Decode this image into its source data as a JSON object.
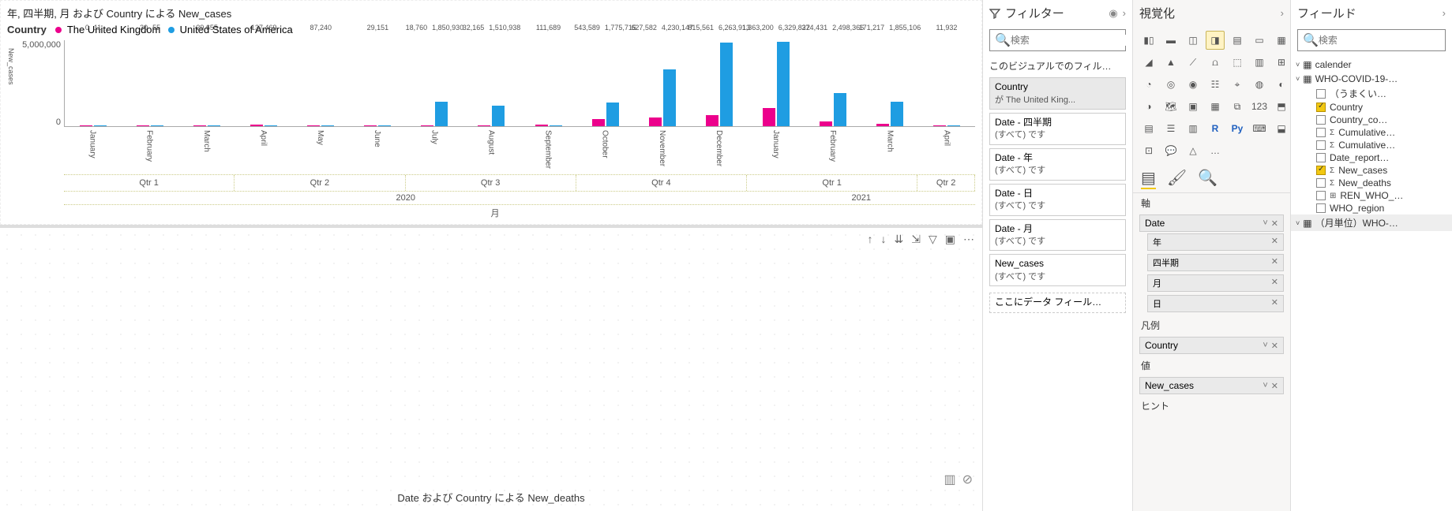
{
  "chart_data": {
    "type": "bar",
    "title": "年, 四半期, 月 および Country による New_cases",
    "ylabel": "New_cases",
    "xlabel": "月",
    "ylim": [
      0,
      6500000
    ],
    "yticks": [
      "5,000,000",
      "0"
    ],
    "legend": {
      "field": "Country",
      "items": [
        "The United Kingdom",
        "United States of America"
      ]
    },
    "categories": [
      "January",
      "February",
      "March",
      "April",
      "May",
      "June",
      "July",
      "August",
      "September",
      "October",
      "November",
      "December",
      "January",
      "February",
      "March",
      "April"
    ],
    "quarters": [
      "Qtr 1",
      "Qtr 2",
      "Qtr 3",
      "Qtr 4",
      "Qtr 1",
      "Qtr 2"
    ],
    "quarter_spans": [
      3,
      3,
      3,
      3,
      3,
      1
    ],
    "years": [
      "2020",
      "2021"
    ],
    "year_spans": [
      12,
      4
    ],
    "series": [
      {
        "name": "The United Kingdom",
        "color": "#ec008c",
        "values": [
          0,
          30,
          29655,
          137469,
          87240,
          29151,
          18760,
          32165,
          111689,
          543589,
          627582,
          815561,
          1363200,
          374431,
          171217,
          11932
        ]
      },
      {
        "name": "United States of America",
        "color": "#1f9de2",
        "values": [
          11,
          55,
          0,
          0,
          0,
          0,
          1850930,
          1510938,
          0,
          1775715,
          4230147,
          6263913,
          6329822,
          2498366,
          1855106,
          0
        ]
      }
    ],
    "data_labels": [
      [
        "0",
        "11"
      ],
      [
        "30",
        "55"
      ],
      [
        "29,655"
      ],
      [
        "137,469"
      ],
      [
        "87,240"
      ],
      [
        "29,151"
      ],
      [
        "18,760",
        "1,850,930"
      ],
      [
        "32,165",
        "1,510,938"
      ],
      [
        "111,689"
      ],
      [
        "543,589",
        "1,775,715"
      ],
      [
        "627,582",
        "4,230,147"
      ],
      [
        "815,561",
        "6,263,913"
      ],
      [
        "1,363,200",
        "6,329,822"
      ],
      [
        "374,431",
        "2,498,366"
      ],
      [
        "171,217",
        "1,855,106"
      ],
      [
        "11,932"
      ]
    ]
  },
  "chart2": {
    "title": "Date および Country による New_deaths"
  },
  "filters": {
    "title": "フィルター",
    "search_placeholder": "検索",
    "section_title": "このビジュアルでのフィル…",
    "cards": [
      {
        "title": "Country",
        "sub": "が The United King...",
        "active": true
      },
      {
        "title": "Date - 四半期",
        "sub": "(すべて) です"
      },
      {
        "title": "Date - 年",
        "sub": "(すべて) です"
      },
      {
        "title": "Date - 日",
        "sub": "(すべて) です"
      },
      {
        "title": "Date - 月",
        "sub": "(すべて) です"
      },
      {
        "title": "New_cases",
        "sub": "(すべて) です"
      }
    ],
    "drop_hint": "ここにデータ フィール…"
  },
  "viz": {
    "title": "視覚化",
    "sections": {
      "axis": "軸",
      "legend": "凡例",
      "value": "値",
      "hint": "ヒント"
    },
    "axis_field": "Date",
    "axis_subs": [
      "年",
      "四半期",
      "月",
      "日"
    ],
    "legend_field": "Country",
    "value_field": "New_cases"
  },
  "fields": {
    "title": "フィールド",
    "search_placeholder": "検索",
    "tables": [
      {
        "name": "calender",
        "expanded": false
      },
      {
        "name": "WHO-COVID-19-…",
        "expanded": true,
        "fields": [
          {
            "name": "（うまくい…",
            "checked": false
          },
          {
            "name": "Country",
            "checked": true
          },
          {
            "name": "Country_co…",
            "checked": false
          },
          {
            "name": "Cumulative…",
            "checked": false,
            "sigma": true
          },
          {
            "name": "Cumulative…",
            "checked": false,
            "sigma": true
          },
          {
            "name": "Date_report…",
            "checked": false
          },
          {
            "name": "New_cases",
            "checked": true,
            "sigma": true
          },
          {
            "name": "New_deaths",
            "checked": false,
            "sigma": true
          },
          {
            "name": "REN_WHO_…",
            "checked": false,
            "icon": "calc"
          },
          {
            "name": "WHO_region",
            "checked": false
          }
        ]
      },
      {
        "name": "（月単位）WHO-…",
        "expanded": false,
        "sel": true
      }
    ]
  }
}
